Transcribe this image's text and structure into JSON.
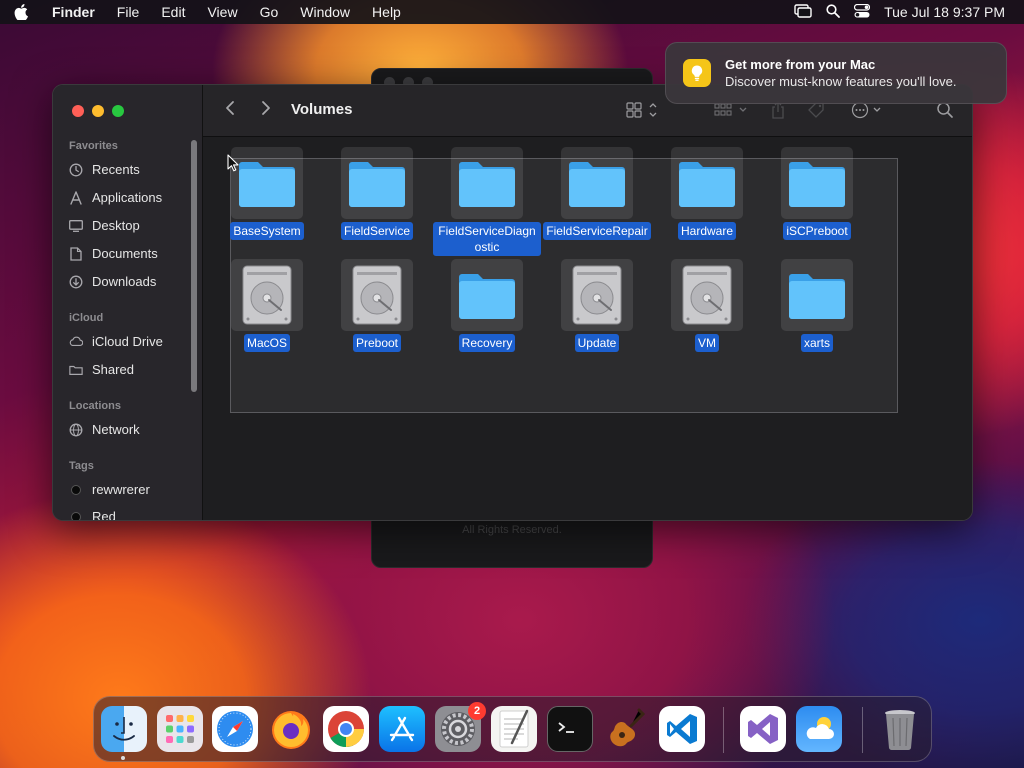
{
  "menubar": {
    "app": "Finder",
    "menus": [
      "File",
      "Edit",
      "View",
      "Go",
      "Window",
      "Help"
    ],
    "clock": "Tue Jul 18  9:37 PM"
  },
  "background_window": {
    "footer_text": "All Rights Reserved."
  },
  "notification": {
    "title": "Get more from your Mac",
    "body": "Discover must-know features you'll love.",
    "icon": "lightbulb-icon",
    "accent": "#f5c518"
  },
  "finder": {
    "title": "Volumes",
    "sidebar": {
      "favorites_header": "Favorites",
      "favorites": [
        {
          "label": "Recents",
          "icon": "clock-icon"
        },
        {
          "label": "Applications",
          "icon": "applications-icon"
        },
        {
          "label": "Desktop",
          "icon": "desktop-icon"
        },
        {
          "label": "Documents",
          "icon": "document-icon"
        },
        {
          "label": "Downloads",
          "icon": "download-icon"
        }
      ],
      "icloud_header": "iCloud",
      "icloud": [
        {
          "label": "iCloud Drive",
          "icon": "cloud-icon"
        },
        {
          "label": "Shared",
          "icon": "shared-folder-icon"
        }
      ],
      "locations_header": "Locations",
      "locations": [
        {
          "label": "Network",
          "icon": "globe-icon"
        }
      ],
      "tags_header": "Tags",
      "tags": [
        {
          "label": "rewwrerer"
        },
        {
          "label": "Red"
        }
      ]
    },
    "items": [
      {
        "label": "BaseSystem",
        "kind": "folder"
      },
      {
        "label": "FieldService",
        "kind": "folder"
      },
      {
        "label": "FieldServiceDiagnostic",
        "kind": "folder"
      },
      {
        "label": "FieldServiceRepair",
        "kind": "folder"
      },
      {
        "label": "Hardware",
        "kind": "folder"
      },
      {
        "label": "iSCPreboot",
        "kind": "folder"
      },
      {
        "label": "MacOS",
        "kind": "drive"
      },
      {
        "label": "Preboot",
        "kind": "drive"
      },
      {
        "label": "Recovery",
        "kind": "folder"
      },
      {
        "label": "Update",
        "kind": "drive"
      },
      {
        "label": "VM",
        "kind": "drive"
      },
      {
        "label": "xarts",
        "kind": "folder"
      }
    ],
    "selection_color": "#1c5fce",
    "folder_color": "#5ac8fa"
  },
  "dock": {
    "apps": [
      {
        "name": "Finder",
        "icon": "finder-icon"
      },
      {
        "name": "Launchpad",
        "icon": "launchpad-icon"
      },
      {
        "name": "Safari",
        "icon": "safari-icon"
      },
      {
        "name": "Firefox",
        "icon": "firefox-icon"
      },
      {
        "name": "Chrome",
        "icon": "chrome-icon"
      },
      {
        "name": "App Store",
        "icon": "app-store-icon"
      },
      {
        "name": "System Settings",
        "icon": "settings-gear-icon",
        "badge": "2"
      },
      {
        "name": "TextEdit",
        "icon": "textedit-icon"
      },
      {
        "name": "Terminal",
        "icon": "terminal-icon"
      },
      {
        "name": "GarageBand",
        "icon": "guitar-icon"
      },
      {
        "name": "Visual Studio Code",
        "icon": "vscode-icon"
      },
      {
        "name": "Visual Studio",
        "icon": "visual-studio-icon"
      },
      {
        "name": "Weather",
        "icon": "weather-icon"
      },
      {
        "name": "Trash",
        "icon": "trash-icon"
      }
    ]
  }
}
